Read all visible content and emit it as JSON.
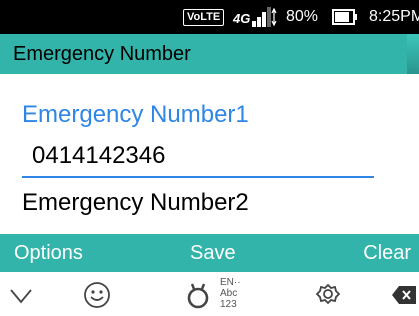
{
  "status_bar": {
    "volte": "VoLTE",
    "network": "4G",
    "battery_percent": "80%",
    "time": "8:25PM"
  },
  "title_bar": {
    "title": "Emergency Number"
  },
  "form": {
    "field1_label": "Emergency Number1",
    "field1_value": "0414142346",
    "field2_label": "Emergency Number2"
  },
  "action_bar": {
    "options_label": "Options",
    "save_label": "Save",
    "clear_label": "Clear"
  },
  "keyboard_toolbar": {
    "icons": [
      "chevron-down-icon",
      "emoji-icon",
      "input-mode-icon",
      "settings-icon",
      "backspace-icon"
    ],
    "input_mode_label": "EN··\nAbc\n123"
  },
  "colors": {
    "accent_teal": "#32b4aa",
    "focus_blue": "#2f86e5",
    "status_black": "#000000"
  }
}
